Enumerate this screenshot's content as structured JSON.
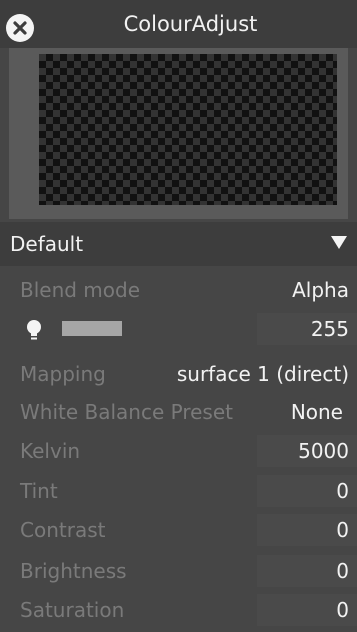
{
  "window": {
    "title": "ColourAdjust"
  },
  "preset": {
    "selected": "Default"
  },
  "rows": {
    "blend_mode": {
      "label": "Blend mode",
      "value": "Alpha"
    },
    "opacity": {
      "value": "255"
    },
    "mapping": {
      "label": "Mapping",
      "value": "surface 1 (direct)"
    },
    "white_balance": {
      "label": "White Balance Preset",
      "value": "None"
    },
    "kelvin": {
      "label": "Kelvin",
      "value": "5000"
    },
    "tint": {
      "label": "Tint",
      "value": "0"
    },
    "contrast": {
      "label": "Contrast",
      "value": "0"
    },
    "brightness": {
      "label": "Brightness",
      "value": "0"
    },
    "saturation": {
      "label": "Saturation",
      "value": "0"
    }
  },
  "icons": {
    "close": "close-icon",
    "bulb": "lightbulb-icon",
    "dropdown": "triangle-down-icon"
  },
  "colors": {
    "background": "#464646",
    "header": "#3d3d3d",
    "text": "#f2f2f2",
    "label_muted": "#7a7a7a"
  }
}
